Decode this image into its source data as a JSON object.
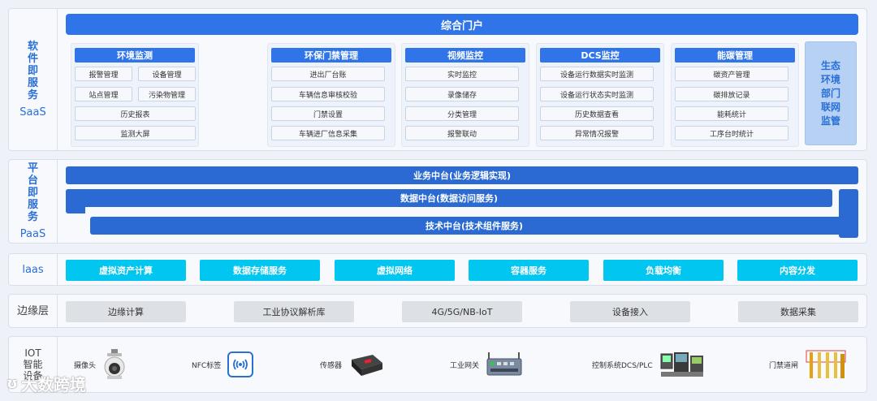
{
  "saas": {
    "label_lines": [
      "软",
      "件",
      "即",
      "服",
      "务"
    ],
    "label_sub": "SaaS",
    "portal": "综合门户",
    "modules": [
      {
        "title": "环境监测",
        "items": [
          "报警管理",
          "设备管理",
          "站点管理",
          "污染物管理",
          "历史报表",
          "监测大屏"
        ]
      },
      {
        "title": "环保门禁管理",
        "items": [
          "进出厂台账",
          "车辆信息审核校验",
          "门禁设置",
          "车辆进厂信息采集"
        ]
      },
      {
        "title": "视频监控",
        "items": [
          "实时监控",
          "录像储存",
          "分类管理",
          "报警联动"
        ]
      },
      {
        "title": "DCS监控",
        "items": [
          "设备运行数据实时监测",
          "设备运行状态实时监测",
          "历史数据查看",
          "异常情况报警"
        ]
      },
      {
        "title": "能碳管理",
        "items": [
          "碳资产管理",
          "碳排放记录",
          "能耗统计",
          "工序台时统计"
        ]
      }
    ],
    "eco_lines": [
      "生态",
      "环境",
      "部门",
      "联网",
      "监管"
    ]
  },
  "paas": {
    "label_lines": [
      "平",
      "台",
      "即",
      "服",
      "务"
    ],
    "label_sub": "PaaS",
    "business": "业务中台(业务逻辑实现)",
    "data": "数据中台(数据访问服务)",
    "tech": "技术中台(技术组件服务)"
  },
  "iaas": {
    "label": "laas",
    "items": [
      "虚拟资产计算",
      "数据存储服务",
      "虚拟网络",
      "容器服务",
      "负载均衡",
      "内容分发"
    ]
  },
  "edge": {
    "label": "边缘层",
    "items": [
      "边缘计算",
      "工业协议解析库",
      "4G/5G/NB-IoT",
      "设备接入",
      "数据采集"
    ]
  },
  "iot": {
    "label_lines": [
      "IOT",
      "智能",
      "设备"
    ],
    "devices": [
      {
        "name": "摄像头",
        "icon": "camera-icon"
      },
      {
        "name": "NFC标签",
        "icon": "nfc-tag-icon"
      },
      {
        "name": "传感器",
        "icon": "sensor-icon"
      },
      {
        "name": "工业网关",
        "icon": "gateway-icon"
      },
      {
        "name": "控制系统DCS/PLC",
        "icon": "plc-icon"
      },
      {
        "name": "门禁道闸",
        "icon": "barrier-gate-icon"
      }
    ]
  },
  "watermark": "大数跨境",
  "colors": {
    "primary": "#2f74e8",
    "paas": "#2a6ad2",
    "iaas": "#00c6f0",
    "edge": "#dde0e5",
    "eco": "#b7d1f4"
  }
}
